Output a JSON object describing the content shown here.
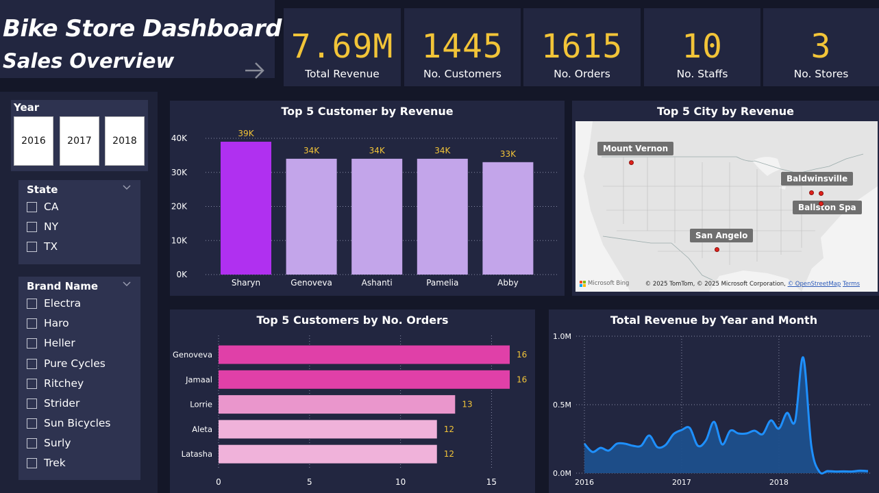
{
  "header": {
    "title": "Bike Store Dashboard",
    "subtitle": "Sales Overview"
  },
  "kpis": [
    {
      "value": "7.69M",
      "label": "Total Revenue"
    },
    {
      "value": "1445",
      "label": "No. Customers"
    },
    {
      "value": "1615",
      "label": "No. Orders"
    },
    {
      "value": "10",
      "label": "No. Staffs"
    },
    {
      "value": "3",
      "label": "No. Stores"
    }
  ],
  "filters": {
    "year": {
      "label": "Year",
      "options": [
        "2016",
        "2017",
        "2018"
      ]
    },
    "state": {
      "label": "State",
      "options": [
        "CA",
        "NY",
        "TX"
      ]
    },
    "brand": {
      "label": "Brand Name",
      "options": [
        "Electra",
        "Haro",
        "Heller",
        "Pure Cycles",
        "Ritchey",
        "Strider",
        "Sun Bicycles",
        "Surly",
        "Trek"
      ]
    }
  },
  "map": {
    "title": "Top 5 City by Revenue",
    "cities": [
      "Mount Vernon",
      "Baldwinsville",
      "Ballston Spa",
      "San Angelo"
    ],
    "credit_text": "© 2025 TomTom, © 2025 Microsoft Corporation, ",
    "credit_link": "© OpenStreetMap",
    "terms": "Terms",
    "logo": "Microsoft Bing"
  },
  "colors": {
    "accent": "#f2c438",
    "highlight_bar": "#b030f0",
    "bar": "#c3a5ea",
    "order_bar_strong": "#e040a8",
    "order_bar_mid": "#ea96cc",
    "order_bar_light": "#f0b2da",
    "line": "#1e90ff",
    "area": "#1e4f8c"
  },
  "chart_data": [
    {
      "type": "bar",
      "title": "Top 5 Customer by Revenue",
      "categories": [
        "Sharyn",
        "Genoveva",
        "Ashanti",
        "Pamelia",
        "Abby"
      ],
      "values": [
        39000,
        34000,
        34000,
        34000,
        33000
      ],
      "data_labels": [
        "39K",
        "34K",
        "34K",
        "34K",
        "33K"
      ],
      "yticks": [
        "0K",
        "10K",
        "20K",
        "30K",
        "40K"
      ],
      "ylim": [
        0,
        40000
      ],
      "grid": true
    },
    {
      "type": "bar",
      "orientation": "horizontal",
      "title": "Top 5 Customers by No. Orders",
      "categories": [
        "Genoveva",
        "Jamaal",
        "Lorrie",
        "Aleta",
        "Latasha"
      ],
      "values": [
        16,
        16,
        13,
        12,
        12
      ],
      "xticks": [
        "0",
        "5",
        "10",
        "15"
      ],
      "xlim": [
        0,
        16
      ],
      "grid": true
    },
    {
      "type": "area",
      "title": "Total Revenue by Year and Month",
      "x": [
        "2016-01",
        "2016-02",
        "2016-03",
        "2016-04",
        "2016-05",
        "2016-06",
        "2016-07",
        "2016-08",
        "2016-09",
        "2016-10",
        "2016-11",
        "2016-12",
        "2017-01",
        "2017-02",
        "2017-03",
        "2017-04",
        "2017-05",
        "2017-06",
        "2017-07",
        "2017-08",
        "2017-09",
        "2017-10",
        "2017-11",
        "2017-12",
        "2018-01",
        "2018-02",
        "2018-03",
        "2018-04",
        "2018-05",
        "2018-06",
        "2018-07",
        "2018-08",
        "2018-09",
        "2018-10",
        "2018-11",
        "2018-12"
      ],
      "values": [
        215000,
        155000,
        185000,
        165000,
        215000,
        215000,
        200000,
        200000,
        275000,
        190000,
        205000,
        285000,
        315000,
        330000,
        200000,
        240000,
        375000,
        210000,
        310000,
        290000,
        290000,
        310000,
        285000,
        385000,
        325000,
        440000,
        380000,
        845000,
        200000,
        10000,
        15000,
        12000,
        13000,
        12000,
        18000,
        15000
      ],
      "xticks": [
        "2016",
        "2017",
        "2018"
      ],
      "yticks": [
        "0.0M",
        "0.5M",
        "1.0M"
      ],
      "ylim": [
        0,
        1000000
      ],
      "grid": true
    }
  ]
}
